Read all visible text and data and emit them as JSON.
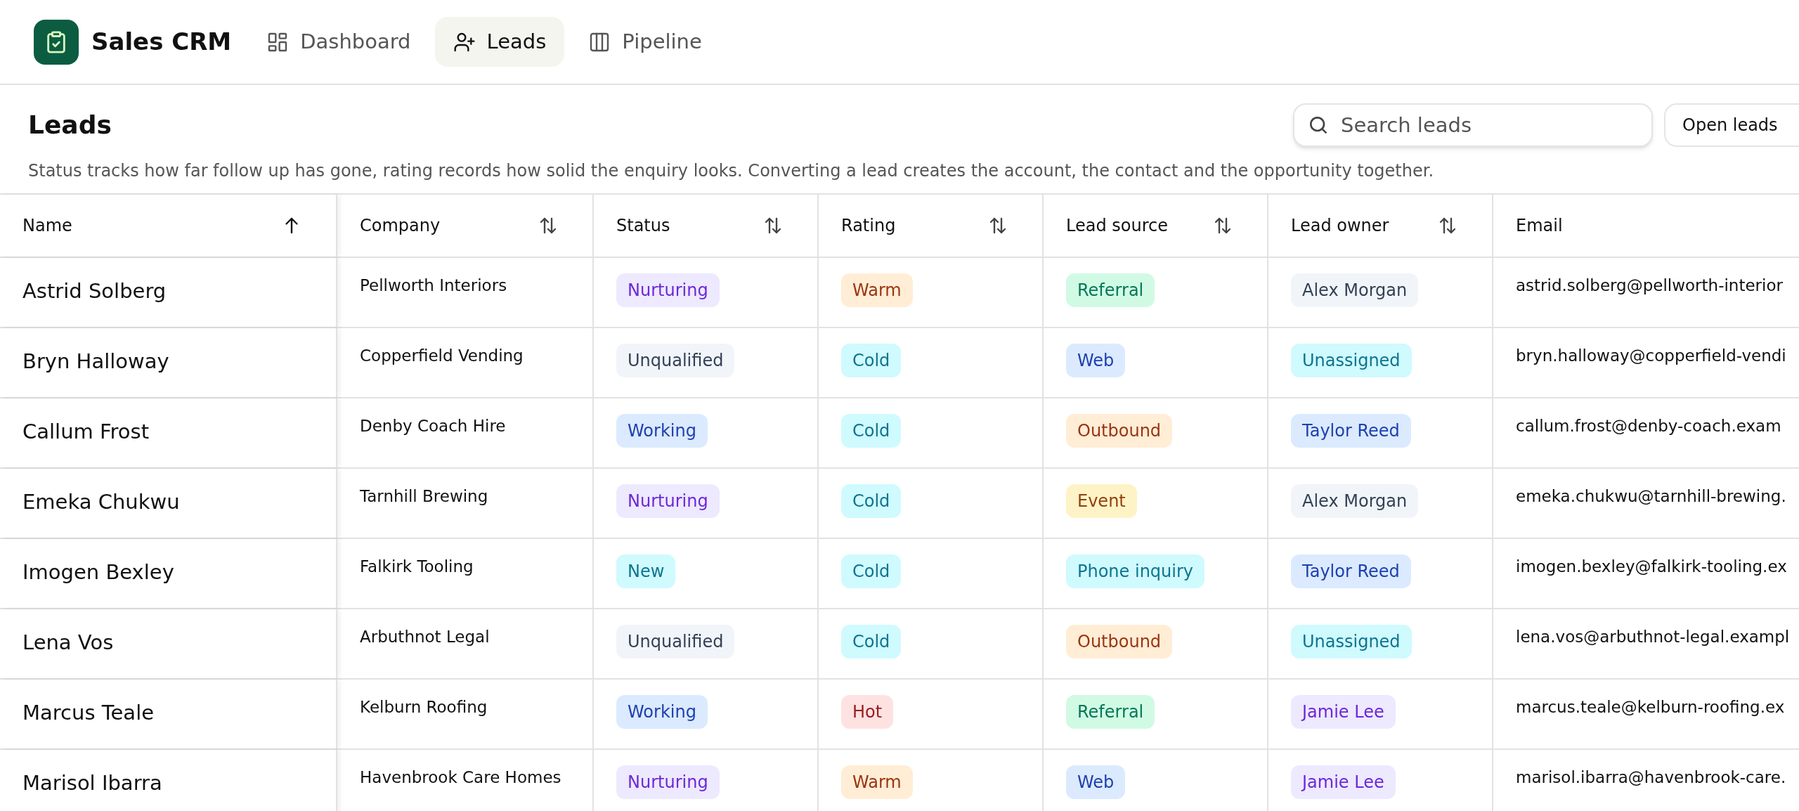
{
  "app": {
    "title": "Sales CRM"
  },
  "nav": [
    {
      "label": "Dashboard",
      "selected": false
    },
    {
      "label": "Leads",
      "selected": true
    },
    {
      "label": "Pipeline",
      "selected": false
    }
  ],
  "page": {
    "title": "Leads",
    "description": "Status tracks how far follow up has gone, rating records how solid the enquiry looks. Converting a lead creates the account, the contact and the opportunity together."
  },
  "search": {
    "placeholder": "Search leads"
  },
  "filter_button": {
    "label": "Open leads"
  },
  "table": {
    "columns": [
      {
        "label": "Name",
        "sortable": true,
        "sorted": true
      },
      {
        "label": "Company",
        "sortable": true,
        "sorted": false
      },
      {
        "label": "Status",
        "sortable": true,
        "sorted": false
      },
      {
        "label": "Rating",
        "sortable": true,
        "sorted": false
      },
      {
        "label": "Lead source",
        "sortable": true,
        "sorted": false
      },
      {
        "label": "Lead owner",
        "sortable": true,
        "sorted": false
      },
      {
        "label": "Email",
        "sortable": false
      }
    ],
    "rows": [
      {
        "name": "Astrid Solberg",
        "company": "Pellworth Interiors",
        "status": {
          "text": "Nurturing",
          "color": "#6d28d9"
        },
        "rating": {
          "text": "Warm",
          "color": "#9a3412"
        },
        "source": {
          "text": "Referral",
          "color": "#047857"
        },
        "owner": {
          "text": "Alex Morgan",
          "color": "#334155"
        },
        "email": "astrid.solberg@pellworth-interior"
      },
      {
        "name": "Bryn Halloway",
        "company": "Copperfield Vending",
        "status": {
          "text": "Unqualified",
          "color": "#334155"
        },
        "rating": {
          "text": "Cold",
          "color": "#0e7490"
        },
        "source": {
          "text": "Web",
          "color": "#1e40af"
        },
        "owner": {
          "text": "Unassigned",
          "color": "#0e7490"
        },
        "email": "bryn.halloway@copperfield-vendi"
      },
      {
        "name": "Callum Frost",
        "company": "Denby Coach Hire",
        "status": {
          "text": "Working",
          "color": "#1e40af"
        },
        "rating": {
          "text": "Cold",
          "color": "#0e7490"
        },
        "source": {
          "text": "Outbound",
          "color": "#9a3412"
        },
        "owner": {
          "text": "Taylor Reed",
          "color": "#1e40af"
        },
        "email": "callum.frost@denby-coach.exam"
      },
      {
        "name": "Emeka Chukwu",
        "company": "Tarnhill Brewing",
        "status": {
          "text": "Nurturing",
          "color": "#6d28d9"
        },
        "rating": {
          "text": "Cold",
          "color": "#0e7490"
        },
        "source": {
          "text": "Event",
          "color": "#92400e"
        },
        "owner": {
          "text": "Alex Morgan",
          "color": "#334155"
        },
        "email": "emeka.chukwu@tarnhill-brewing."
      },
      {
        "name": "Imogen Bexley",
        "company": "Falkirk Tooling",
        "status": {
          "text": "New",
          "color": "#0e7490"
        },
        "rating": {
          "text": "Cold",
          "color": "#0e7490"
        },
        "source": {
          "text": "Phone inquiry",
          "color": "#0e7490"
        },
        "owner": {
          "text": "Taylor Reed",
          "color": "#1e40af"
        },
        "email": "imogen.bexley@falkirk-tooling.ex"
      },
      {
        "name": "Lena Vos",
        "company": "Arbuthnot Legal",
        "status": {
          "text": "Unqualified",
          "color": "#334155"
        },
        "rating": {
          "text": "Cold",
          "color": "#0e7490"
        },
        "source": {
          "text": "Outbound",
          "color": "#9a3412"
        },
        "owner": {
          "text": "Unassigned",
          "color": "#0e7490"
        },
        "email": "lena.vos@arbuthnot-legal.exampl"
      },
      {
        "name": "Marcus Teale",
        "company": "Kelburn Roofing",
        "status": {
          "text": "Working",
          "color": "#1e40af"
        },
        "rating": {
          "text": "Hot",
          "color": "#991b1b"
        },
        "source": {
          "text": "Referral",
          "color": "#047857"
        },
        "owner": {
          "text": "Jamie Lee",
          "color": "#6d28d9"
        },
        "email": "marcus.teale@kelburn-roofing.ex"
      },
      {
        "name": "Marisol Ibarra",
        "company": "Havenbrook Care Homes",
        "status": {
          "text": "Nurturing",
          "color": "#6d28d9"
        },
        "rating": {
          "text": "Warm",
          "color": "#9a3412"
        },
        "source": {
          "text": "Web",
          "color": "#1e40af"
        },
        "owner": {
          "text": "Jamie Lee",
          "color": "#6d28d9"
        },
        "email": "marisol.ibarra@havenbrook-care."
      }
    ]
  }
}
